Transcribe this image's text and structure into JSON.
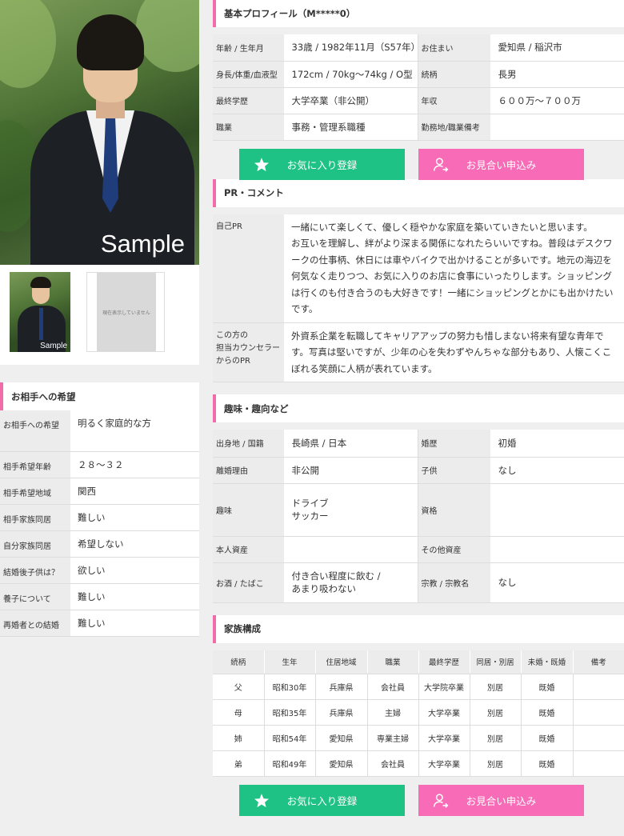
{
  "photo": {
    "sample_label": "Sample",
    "thumb_sample_label": "Sample",
    "no_image_label": "現在表示していません"
  },
  "wish": {
    "title": "お相手への希望",
    "rows": [
      {
        "k": "お相手への希望",
        "v": "明るく家庭的な方"
      },
      {
        "k": "相手希望年齢",
        "v": "２８～３２"
      },
      {
        "k": "相手希望地域",
        "v": "関西"
      },
      {
        "k": "相手家族同居",
        "v": "難しい"
      },
      {
        "k": "自分家族同居",
        "v": "希望しない"
      },
      {
        "k": "結婚後子供は？",
        "v": "欲しい"
      },
      {
        "k": "養子について",
        "v": "難しい"
      },
      {
        "k": "再婚者との結婚",
        "v": "難しい"
      }
    ]
  },
  "profile": {
    "title": "基本プロフィール（M*****0）",
    "rows": [
      {
        "k1": "年齢 / 生年月",
        "v1": "33歳 / 1982年11月（S57年）",
        "k2": "お住まい",
        "v2": "愛知県 / 稲沢市"
      },
      {
        "k1": "身長/体重/血液型",
        "v1": "172cm / 70kg～74kg / O型",
        "k2": "続柄",
        "v2": "長男"
      },
      {
        "k1": "最終学歴",
        "v1": "大学卒業（非公開）",
        "k2": "年収",
        "v2": "６００万～７００万"
      },
      {
        "k1": "職業",
        "v1": "事務・管理系職種",
        "k2": "勤務地/職業備考",
        "v2": ""
      }
    ]
  },
  "buttons": {
    "fav": "お気に入り登録",
    "meet": "お見合い申込み"
  },
  "pr": {
    "title": "PR・コメント",
    "self_key": "自己PR",
    "self_text": "一緒にいて楽しくて、優しく穏やかな家庭を築いていきたいと思います。\nお互いを理解し、絆がより深まる関係になれたらいいですね。普段はデスクワークの仕事柄、休日には車やバイクで出かけることが多いです。地元の海辺を何気なく走りつつ、お気に入りのお店に食事にいったりします。ショッピングは行くのも付き合うのも大好きです！一緒にショッピングとかにも出かけたいです。",
    "counselor_key": "この方の\n担当カウンセラー\nからのPR",
    "counselor_text": "外資系企業を転職してキャリアアップの努力も惜しまない将来有望な青年です。写真は堅いですが、少年の心を失わずやんちゃな部分もあり、人懐こくこぼれる笑顔に人柄が表れています。"
  },
  "hobby": {
    "title": "趣味・趣向など",
    "rows": [
      {
        "k1": "出身地 / 国籍",
        "v1": "長崎県 / 日本",
        "k2": "婚歴",
        "v2": "初婚"
      },
      {
        "k1": "離婚理由",
        "v1": "非公開",
        "k2": "子供",
        "v2": "なし"
      },
      {
        "k1": "趣味",
        "v1": "ドライブ\nサッカー",
        "k2": "資格",
        "v2": ""
      },
      {
        "k1": "本人資産",
        "v1": "",
        "k2": "その他資産",
        "v2": ""
      },
      {
        "k1": "お酒 / たばこ",
        "v1": "付き合い程度に飲む /\nあまり吸わない",
        "k2": "宗教 / 宗教名",
        "v2": "なし"
      }
    ]
  },
  "family": {
    "title": "家族構成",
    "headers": [
      "続柄",
      "生年",
      "住居地域",
      "職業",
      "最終学歴",
      "同居・別居",
      "未婚・既婚",
      "備考"
    ],
    "rows": [
      [
        "父",
        "昭和30年",
        "兵庫県",
        "会社員",
        "大学院卒業",
        "別居",
        "既婚",
        ""
      ],
      [
        "母",
        "昭和35年",
        "兵庫県",
        "主婦",
        "大学卒業",
        "別居",
        "既婚",
        ""
      ],
      [
        "姉",
        "昭和54年",
        "愛知県",
        "専業主婦",
        "大学卒業",
        "別居",
        "既婚",
        ""
      ],
      [
        "弟",
        "昭和49年",
        "愛知県",
        "会社員",
        "大学卒業",
        "別居",
        "既婚",
        ""
      ]
    ]
  }
}
